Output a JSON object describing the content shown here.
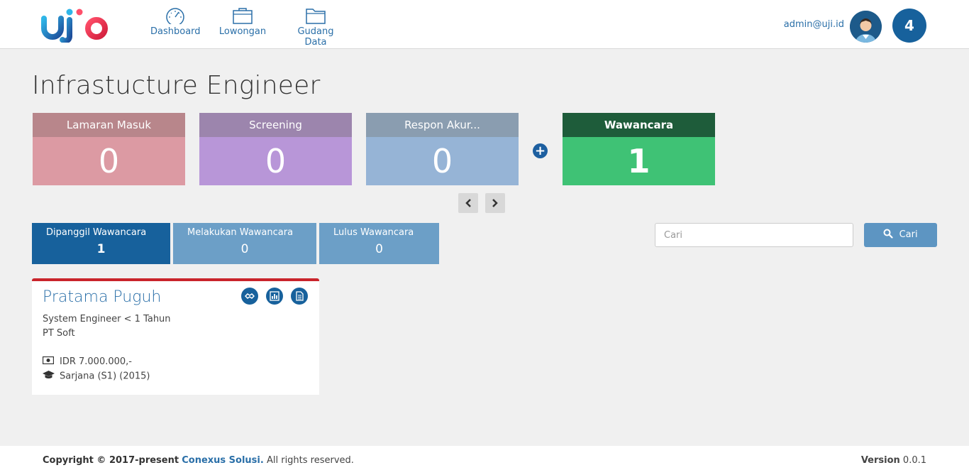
{
  "header": {
    "logo_text": "ujiid",
    "nav": [
      {
        "label": "Dashboard",
        "icon": "speedometer-icon"
      },
      {
        "label": "Lowongan",
        "icon": "briefcase-icon"
      },
      {
        "label": "Gudang Data",
        "icon": "folder-icon"
      }
    ],
    "user_email": "admin@uji.id",
    "notification_count": "4"
  },
  "page": {
    "title": "Infrastucture Engineer"
  },
  "stages": [
    {
      "label": "Lamaran Masuk",
      "count": "0"
    },
    {
      "label": "Screening",
      "count": "0"
    },
    {
      "label": "Respon Akur...",
      "count": "0"
    },
    {
      "label": "Wawancara",
      "count": "1"
    }
  ],
  "sub_tabs": [
    {
      "label": "Dipanggil Wawancara",
      "count": "1"
    },
    {
      "label": "Melakukan Wawancara",
      "count": "0"
    },
    {
      "label": "Lulus Wawancara",
      "count": "0"
    }
  ],
  "search": {
    "placeholder": "Cari",
    "button_label": "Cari"
  },
  "candidate": {
    "name": "Pratama Puguh",
    "role": "System Engineer < 1 Tahun",
    "company": "PT Soft",
    "salary": "IDR 7.000.000,-",
    "education": "Sarjana (S1) (2015)"
  },
  "footer": {
    "copyright_prefix": "Copyright © 2017-present",
    "company": "Conexus Solusi.",
    "copyright_suffix": "All rights reserved.",
    "version_label": "Version",
    "version_value": "0.0.1"
  },
  "colors": {
    "primary": "#17619c",
    "accent_red": "#c9242b",
    "stage_interview": "#3fc275"
  }
}
